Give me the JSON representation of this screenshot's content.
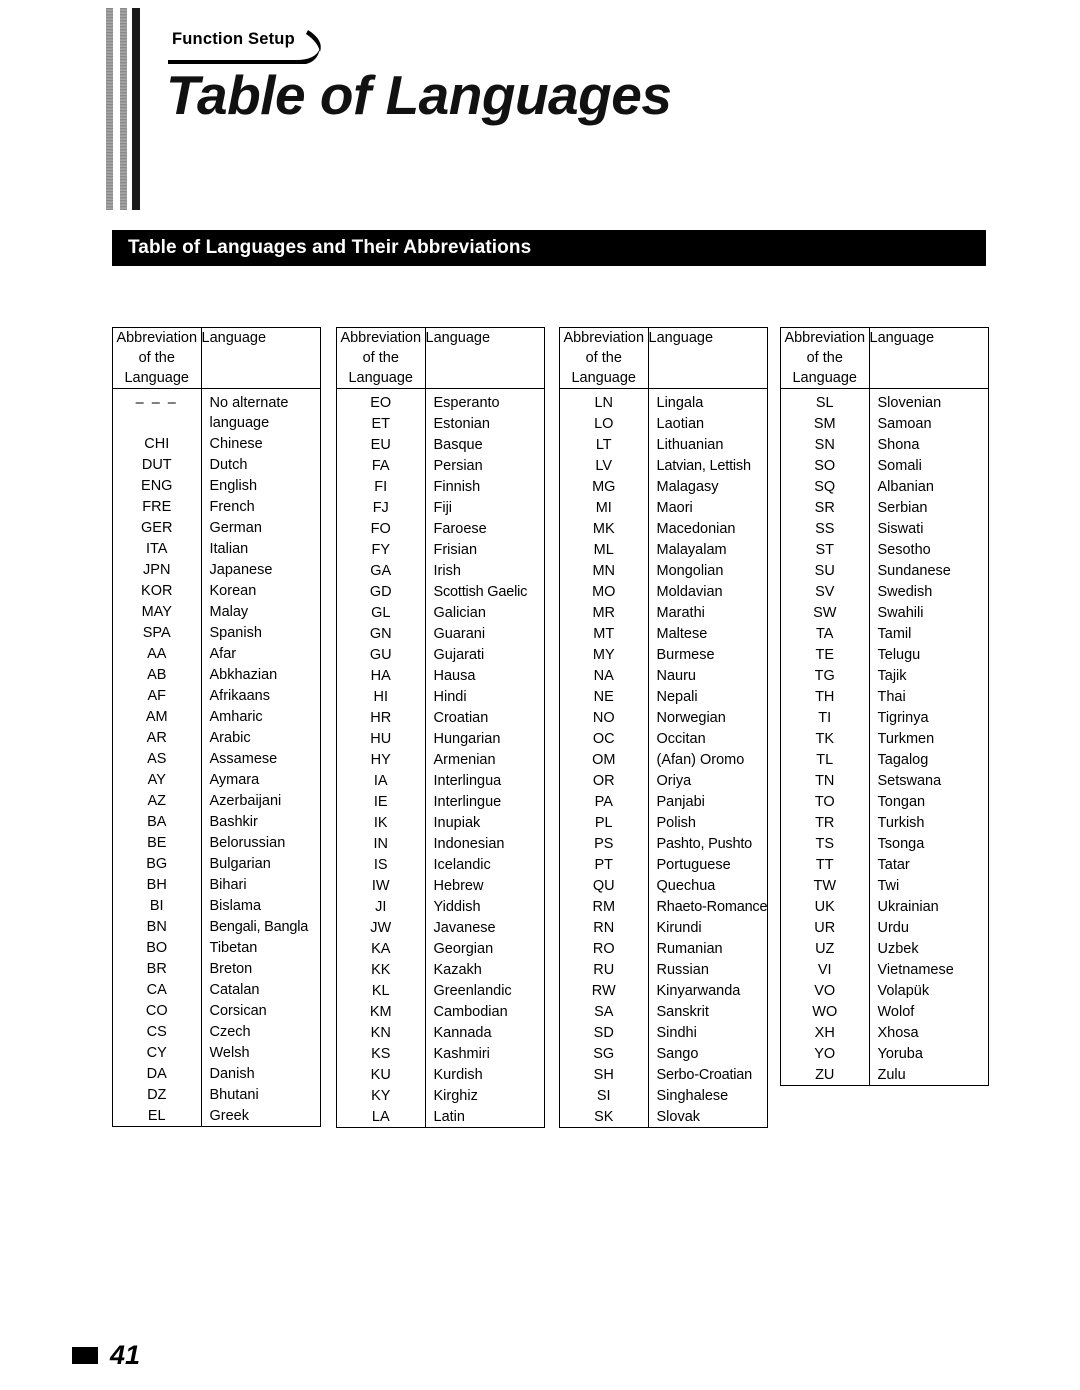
{
  "header": {
    "tab_label": "Function Setup",
    "title": "Table of Languages",
    "banner_title": "Table of Languages and Their Abbreviations"
  },
  "table_headers": {
    "abbreviation": "Abbreviation\nof the\nLanguage",
    "abbreviation_line1": "Abbreviation",
    "abbreviation_line2": "of the",
    "abbreviation_line3": "Language",
    "language": "Language"
  },
  "footer": {
    "page_number": "41"
  },
  "colors": {
    "banner_background": "#000000",
    "banner_text": "#ffffff",
    "text": "#000000",
    "page_background": "#ffffff"
  },
  "columns": [
    {
      "rows": [
        {
          "abbr": "– – –",
          "lang": "No alternate\nlanguage",
          "lang_lines": [
            "No alternate",
            "language"
          ],
          "abbr_style": "dashes"
        },
        {
          "abbr": "CHI",
          "lang": "Chinese"
        },
        {
          "abbr": "DUT",
          "lang": "Dutch"
        },
        {
          "abbr": "ENG",
          "lang": "English"
        },
        {
          "abbr": "FRE",
          "lang": "French"
        },
        {
          "abbr": "GER",
          "lang": "German"
        },
        {
          "abbr": "ITA",
          "lang": "Italian"
        },
        {
          "abbr": "JPN",
          "lang": "Japanese"
        },
        {
          "abbr": "KOR",
          "lang": "Korean"
        },
        {
          "abbr": "MAY",
          "lang": "Malay"
        },
        {
          "abbr": "SPA",
          "lang": "Spanish"
        },
        {
          "abbr": "AA",
          "lang": "Afar"
        },
        {
          "abbr": "AB",
          "lang": "Abkhazian"
        },
        {
          "abbr": "AF",
          "lang": "Afrikaans"
        },
        {
          "abbr": "AM",
          "lang": "Amharic"
        },
        {
          "abbr": "AR",
          "lang": "Arabic"
        },
        {
          "abbr": "AS",
          "lang": "Assamese"
        },
        {
          "abbr": "AY",
          "lang": "Aymara"
        },
        {
          "abbr": "AZ",
          "lang": "Azerbaijani"
        },
        {
          "abbr": "BA",
          "lang": "Bashkir"
        },
        {
          "abbr": "BE",
          "lang": "Belorussian"
        },
        {
          "abbr": "BG",
          "lang": "Bulgarian"
        },
        {
          "abbr": "BH",
          "lang": "Bihari"
        },
        {
          "abbr": "BI",
          "lang": "Bislama"
        },
        {
          "abbr": "BN",
          "lang": "Bengali, Bangla",
          "small": true
        },
        {
          "abbr": "BO",
          "lang": "Tibetan"
        },
        {
          "abbr": "BR",
          "lang": "Breton"
        },
        {
          "abbr": "CA",
          "lang": "Catalan"
        },
        {
          "abbr": "CO",
          "lang": "Corsican"
        },
        {
          "abbr": "CS",
          "lang": "Czech"
        },
        {
          "abbr": "CY",
          "lang": "Welsh"
        },
        {
          "abbr": "DA",
          "lang": "Danish"
        },
        {
          "abbr": "DZ",
          "lang": "Bhutani"
        },
        {
          "abbr": "EL",
          "lang": "Greek"
        }
      ]
    },
    {
      "rows": [
        {
          "abbr": "EO",
          "lang": "Esperanto"
        },
        {
          "abbr": "ET",
          "lang": "Estonian"
        },
        {
          "abbr": "EU",
          "lang": "Basque"
        },
        {
          "abbr": "FA",
          "lang": "Persian"
        },
        {
          "abbr": "FI",
          "lang": "Finnish"
        },
        {
          "abbr": "FJ",
          "lang": "Fiji"
        },
        {
          "abbr": "FO",
          "lang": "Faroese"
        },
        {
          "abbr": "FY",
          "lang": "Frisian"
        },
        {
          "abbr": "GA",
          "lang": "Irish"
        },
        {
          "abbr": "GD",
          "lang": "Scottish Gaelic",
          "small": true
        },
        {
          "abbr": "GL",
          "lang": "Galician"
        },
        {
          "abbr": "GN",
          "lang": "Guarani"
        },
        {
          "abbr": "GU",
          "lang": "Gujarati"
        },
        {
          "abbr": "HA",
          "lang": "Hausa"
        },
        {
          "abbr": "HI",
          "lang": "Hindi"
        },
        {
          "abbr": "HR",
          "lang": "Croatian"
        },
        {
          "abbr": "HU",
          "lang": "Hungarian"
        },
        {
          "abbr": "HY",
          "lang": "Armenian"
        },
        {
          "abbr": "IA",
          "lang": "Interlingua"
        },
        {
          "abbr": "IE",
          "lang": "Interlingue"
        },
        {
          "abbr": "IK",
          "lang": "Inupiak"
        },
        {
          "abbr": "IN",
          "lang": "Indonesian"
        },
        {
          "abbr": "IS",
          "lang": "Icelandic"
        },
        {
          "abbr": "IW",
          "lang": "Hebrew"
        },
        {
          "abbr": "JI",
          "lang": "Yiddish"
        },
        {
          "abbr": "JW",
          "lang": "Javanese"
        },
        {
          "abbr": "KA",
          "lang": "Georgian"
        },
        {
          "abbr": "KK",
          "lang": "Kazakh"
        },
        {
          "abbr": "KL",
          "lang": "Greenlandic"
        },
        {
          "abbr": "KM",
          "lang": "Cambodian"
        },
        {
          "abbr": "KN",
          "lang": "Kannada"
        },
        {
          "abbr": "KS",
          "lang": "Kashmiri"
        },
        {
          "abbr": "KU",
          "lang": "Kurdish"
        },
        {
          "abbr": "KY",
          "lang": "Kirghiz"
        },
        {
          "abbr": "LA",
          "lang": "Latin"
        }
      ]
    },
    {
      "rows": [
        {
          "abbr": "LN",
          "lang": "Lingala"
        },
        {
          "abbr": "LO",
          "lang": "Laotian"
        },
        {
          "abbr": "LT",
          "lang": "Lithuanian"
        },
        {
          "abbr": "LV",
          "lang": "Latvian, Lettish",
          "small": true
        },
        {
          "abbr": "MG",
          "lang": "Malagasy"
        },
        {
          "abbr": "MI",
          "lang": "Maori"
        },
        {
          "abbr": "MK",
          "lang": "Macedonian"
        },
        {
          "abbr": "ML",
          "lang": "Malayalam"
        },
        {
          "abbr": "MN",
          "lang": "Mongolian"
        },
        {
          "abbr": "MO",
          "lang": "Moldavian"
        },
        {
          "abbr": "MR",
          "lang": "Marathi"
        },
        {
          "abbr": "MT",
          "lang": "Maltese"
        },
        {
          "abbr": "MY",
          "lang": "Burmese"
        },
        {
          "abbr": "NA",
          "lang": "Nauru"
        },
        {
          "abbr": "NE",
          "lang": "Nepali"
        },
        {
          "abbr": "NO",
          "lang": "Norwegian"
        },
        {
          "abbr": "OC",
          "lang": "Occitan"
        },
        {
          "abbr": "OM",
          "lang": "(Afan) Oromo"
        },
        {
          "abbr": "OR",
          "lang": "Oriya"
        },
        {
          "abbr": "PA",
          "lang": "Panjabi"
        },
        {
          "abbr": "PL",
          "lang": "Polish"
        },
        {
          "abbr": "PS",
          "lang": "Pashto, Pushto",
          "small": true
        },
        {
          "abbr": "PT",
          "lang": "Portuguese"
        },
        {
          "abbr": "QU",
          "lang": "Quechua"
        },
        {
          "abbr": "RM",
          "lang": "Rhaeto-Romance",
          "small": true
        },
        {
          "abbr": "RN",
          "lang": "Kirundi"
        },
        {
          "abbr": "RO",
          "lang": "Rumanian"
        },
        {
          "abbr": "RU",
          "lang": "Russian"
        },
        {
          "abbr": "RW",
          "lang": "Kinyarwanda"
        },
        {
          "abbr": "SA",
          "lang": "Sanskrit"
        },
        {
          "abbr": "SD",
          "lang": "Sindhi"
        },
        {
          "abbr": "SG",
          "lang": "Sango"
        },
        {
          "abbr": "SH",
          "lang": "Serbo-Croatian",
          "small": true
        },
        {
          "abbr": "SI",
          "lang": "Singhalese"
        },
        {
          "abbr": "SK",
          "lang": "Slovak"
        }
      ]
    },
    {
      "rows": [
        {
          "abbr": "SL",
          "lang": "Slovenian"
        },
        {
          "abbr": "SM",
          "lang": "Samoan"
        },
        {
          "abbr": "SN",
          "lang": "Shona"
        },
        {
          "abbr": "SO",
          "lang": "Somali"
        },
        {
          "abbr": "SQ",
          "lang": "Albanian"
        },
        {
          "abbr": "SR",
          "lang": "Serbian"
        },
        {
          "abbr": "SS",
          "lang": "Siswati"
        },
        {
          "abbr": "ST",
          "lang": "Sesotho"
        },
        {
          "abbr": "SU",
          "lang": "Sundanese"
        },
        {
          "abbr": "SV",
          "lang": "Swedish"
        },
        {
          "abbr": "SW",
          "lang": "Swahili"
        },
        {
          "abbr": "TA",
          "lang": "Tamil"
        },
        {
          "abbr": "TE",
          "lang": "Telugu"
        },
        {
          "abbr": "TG",
          "lang": "Tajik"
        },
        {
          "abbr": "TH",
          "lang": "Thai"
        },
        {
          "abbr": "TI",
          "lang": "Tigrinya"
        },
        {
          "abbr": "TK",
          "lang": "Turkmen"
        },
        {
          "abbr": "TL",
          "lang": "Tagalog"
        },
        {
          "abbr": "TN",
          "lang": "Setswana"
        },
        {
          "abbr": "TO",
          "lang": "Tongan"
        },
        {
          "abbr": "TR",
          "lang": "Turkish"
        },
        {
          "abbr": "TS",
          "lang": "Tsonga"
        },
        {
          "abbr": "TT",
          "lang": "Tatar"
        },
        {
          "abbr": "TW",
          "lang": "Twi"
        },
        {
          "abbr": "UK",
          "lang": "Ukrainian"
        },
        {
          "abbr": "UR",
          "lang": "Urdu"
        },
        {
          "abbr": "UZ",
          "lang": "Uzbek"
        },
        {
          "abbr": "VI",
          "lang": "Vietnamese"
        },
        {
          "abbr": "VO",
          "lang": "Volapük"
        },
        {
          "abbr": "WO",
          "lang": "Wolof"
        },
        {
          "abbr": "XH",
          "lang": "Xhosa"
        },
        {
          "abbr": "YO",
          "lang": "Yoruba"
        },
        {
          "abbr": "ZU",
          "lang": "Zulu"
        }
      ]
    }
  ]
}
